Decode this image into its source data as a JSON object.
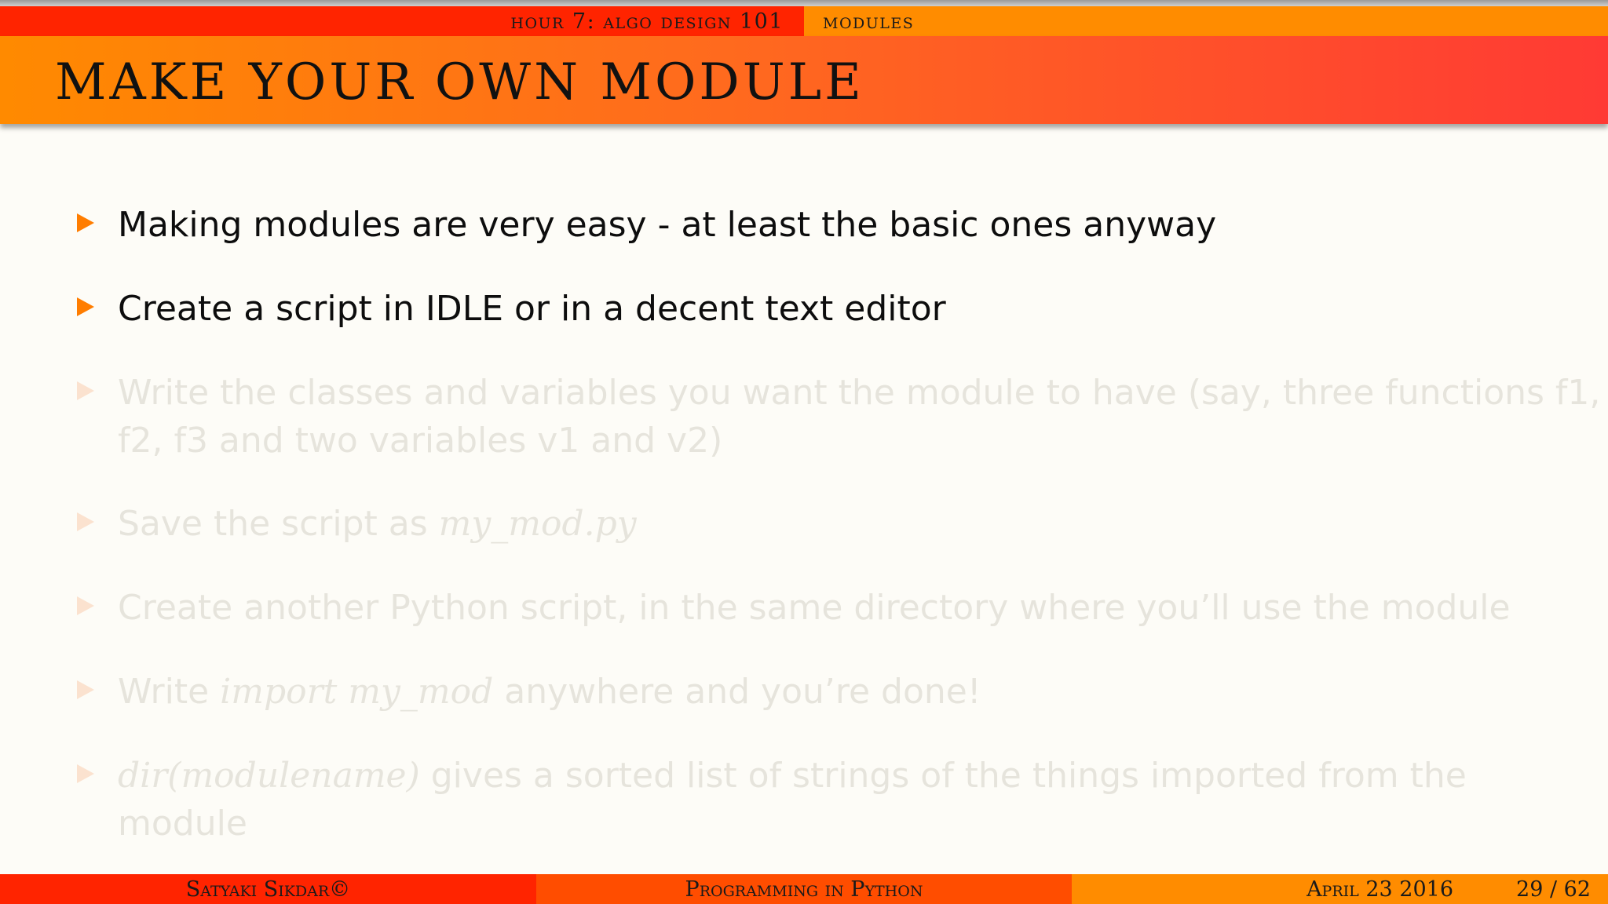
{
  "header": {
    "section": "hour 7: algo design 101",
    "subsection": "modules"
  },
  "title": "Make Your Own Module",
  "bullets": [
    {
      "text": "Making modules are very easy - at least the basic ones anyway",
      "visible": true
    },
    {
      "text": "Create a script in IDLE or in a decent text editor",
      "visible": true
    },
    {
      "text": "Write the classes and variables you want the module to have (say, three functions f1, f2, f3 and two variables v1 and v2)",
      "visible": false
    },
    {
      "before": "Save the script as ",
      "math": "my_mod.py",
      "after": "",
      "visible": false
    },
    {
      "text": "Create another Python script, in the same directory where you’ll use the module",
      "visible": false
    },
    {
      "before": "Write ",
      "math": "import my_mod",
      "after": " anywhere and you’re done!",
      "visible": false
    },
    {
      "before": "",
      "math": "dir(modulename)",
      "after": " gives a sorted list of strings of the things imported from the module",
      "visible": false
    }
  ],
  "footer": {
    "author": "Satyaki Sikdar©",
    "course": "Programming in Python",
    "date": "April 23 2016",
    "page": "29 / 62"
  },
  "colors": {
    "accent_orange": "#ff8c00",
    "accent_red": "#ff2400",
    "bullet_arrow": "#ff7d00",
    "background": "#fdfcf7"
  }
}
